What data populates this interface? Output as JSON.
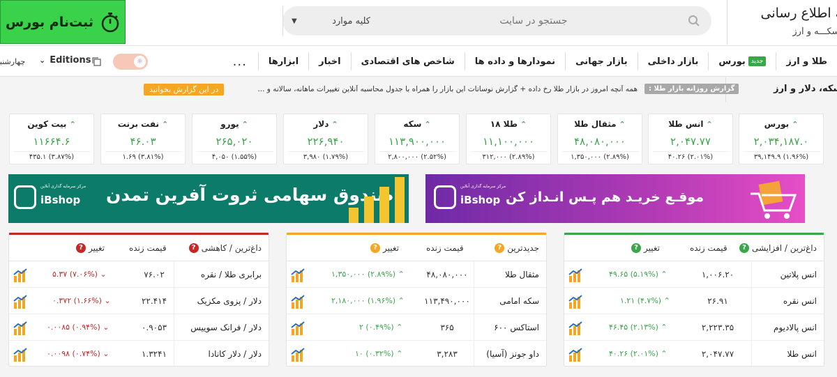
{
  "header": {
    "register_label": "ثبت‌نام بورس",
    "search_placeholder": "جستجو در سایت",
    "filter_label": "کلیه موارد",
    "brand_title": "شبکه اطلاع رسانی",
    "brand_sub": "طلا، سکـــه و ارز",
    "register_color": "#3ad24a"
  },
  "nav": {
    "items": [
      {
        "label": "طلا و ارز"
      },
      {
        "label": "بورس",
        "tag": "جدید"
      },
      {
        "label": "بازار داخلی"
      },
      {
        "label": "بازار جهانی"
      },
      {
        "label": "نمودارها و داده ها"
      },
      {
        "label": "شاخص های اقتصادی"
      },
      {
        "label": "اخبار"
      },
      {
        "label": "ابزارها"
      }
    ],
    "more": "...",
    "editions_label": "Editions",
    "weekday": "چهارشنبه"
  },
  "ticker": {
    "heading": "قیمت سکه، دلار و ارز",
    "label": "گزارش روزانه بازار طلا :",
    "text": "همه آنچه امروز در بازار طلا رخ داده + گزارش نوسانات این بازار را همراه با جدول محاسبه آنلاین تغییرات ماهانه، سالانه و ...",
    "link": "در این گزارش بخوانید"
  },
  "cards": [
    {
      "name": "بورس",
      "price": "۲,۰۳۴,۱۸۷.۰",
      "change": "۳۹,۱۴۹.۹ (۱.۹۶%)"
    },
    {
      "name": "انس طلا",
      "price": "۲,۰۴۷.۷۷",
      "change": "۴۰.۲۶ (۲.۰۱%)"
    },
    {
      "name": "مثقال طلا",
      "price": "۴۸,۰۸۰,۰۰۰",
      "change": "۱,۳۵۰,۰۰۰ (۲.۸۹%)"
    },
    {
      "name": "طلا ۱۸",
      "price": "۱۱,۱۰۰,۰۰۰",
      "change": "۳۱۲,۰۰۰ (۲.۸۹%)"
    },
    {
      "name": "سکه",
      "price": "۱۱۳,۹۰۰,۰۰۰",
      "change": "۲,۸۰۰,۰۰۰ (۲.۵۲%)"
    },
    {
      "name": "دلار",
      "price": "۲۲۶,۹۴۰",
      "change": "۳,۹۸۰ (۱.۷۹%)"
    },
    {
      "name": "یورو",
      "price": "۲۶۵,۰۲۰",
      "change": "۴,۰۵۰ (۱.۵۵%)"
    },
    {
      "name": "نفت برنت",
      "price": "۴۶.۰۳",
      "change": "۱.۶۹ (۳.۸۱%)"
    },
    {
      "name": "بیت کوین",
      "price": "۱۱۶۶۴.۶",
      "change": "۴۳۵.۱ (۳.۸۷%)"
    }
  ],
  "banners": {
    "left_title": "صندوق سهامی ثروت آفرین تمدن",
    "right_title": "موقـع خریـد هم پـس انـداز کن",
    "logo_text": "iBshop",
    "logo_sub": "مرکز سرمایه گذاری آنلاین"
  },
  "tables": {
    "gainers": {
      "title": "داغ‌ترین / افزایشی",
      "col_price": "قیمت زنده",
      "col_change": "تغییر",
      "color": "#3aa64a",
      "rows": [
        {
          "name": "انس پلاتین",
          "price": "۱,۰۰۶.۲۰",
          "change": "۴۹.۶۵ (۵.۱۹%)"
        },
        {
          "name": "انس نقره",
          "price": "۲۶.۹۱",
          "change": "۱.۲۱ (۴.۷%)"
        },
        {
          "name": "انس پالادیوم",
          "price": "۲,۲۲۳.۳۵",
          "change": "۴۶.۴۵ (۲.۱۳%)"
        },
        {
          "name": "انس طلا",
          "price": "۲,۰۴۷.۷۷",
          "change": "۴۰.۲۶ (۲.۰۱%)"
        }
      ]
    },
    "newest": {
      "title": "جدیدترین",
      "col_price": "قیمت زنده",
      "col_change": "تغییر",
      "color": "#f5a623",
      "rows": [
        {
          "name": "مثقال طلا",
          "price": "۴۸,۰۸۰,۰۰۰",
          "change": "۱,۳۵۰,۰۰۰ (۲.۸۹%)"
        },
        {
          "name": "سکه امامی",
          "price": "۱۱۳,۴۹۰,۰۰۰",
          "change": "۲,۱۸۰,۰۰۰ (۱.۹۶%)"
        },
        {
          "name": "استاکس ۶۰۰",
          "price": "۳۶۵",
          "change": "۲ (۰.۴۹%)"
        },
        {
          "name": "داو جونز (آسیا)",
          "price": "۳,۲۸۳",
          "change": "۱۰ (۰.۳۲%)"
        }
      ]
    },
    "losers": {
      "title": "داغ‌ترین / کاهشی",
      "col_price": "قیمت زنده",
      "col_change": "تغییر",
      "color": "#c62828",
      "rows": [
        {
          "name": "برابری طلا / نقره",
          "price": "۷۶.۰۲",
          "change": "۵.۳۷ (۷.۰۶%)"
        },
        {
          "name": "دلار / پزوی مکزیک",
          "price": "۲۲.۴۱۴",
          "change": "۰.۳۷۲ (۱.۶۶%)"
        },
        {
          "name": "دلار / فرانک سوییس",
          "price": "۰.۹۰۵۳",
          "change": "۰.۰۰۸۵ (۰.۹۴%)"
        },
        {
          "name": "دلار / دلار کانادا",
          "price": "۱.۳۲۴۱",
          "change": "۰.۰۰۹۸ (۰.۷۴%)"
        }
      ]
    }
  }
}
